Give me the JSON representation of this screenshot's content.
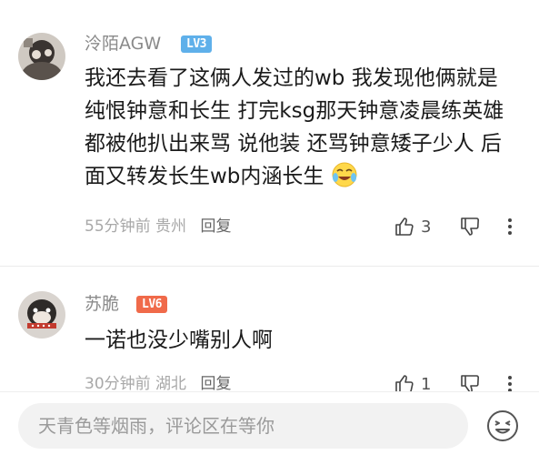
{
  "comments": [
    {
      "username": "泠陌AGW",
      "level": "LV3",
      "text": "我还去看了这俩人发过的wb 我发现他俩就是纯恨钟意和长生 打完ksg那天钟意凌晨练英雄都被他扒出来骂 说他装 还骂钟意矮子少人 后面又转发长生wb内涵长生",
      "time": "55分钟前",
      "location": "贵州",
      "reply_label": "回复",
      "likes": "3"
    },
    {
      "username": "苏脆",
      "level": "LV6",
      "text": "一诺也没少嘴别人啊",
      "time": "30分钟前",
      "location": "湖北",
      "reply_label": "回复",
      "likes": "1"
    }
  ],
  "composer": {
    "placeholder": "天青色等烟雨，评论区在等你"
  },
  "colors": {
    "lv3": "#5fb0ea",
    "lv6": "#f06a4a"
  },
  "icons": [
    "thumbs-up-icon",
    "thumbs-down-icon",
    "more-vertical-icon",
    "crying-laughing-emoji-icon",
    "smiley-icon"
  ]
}
